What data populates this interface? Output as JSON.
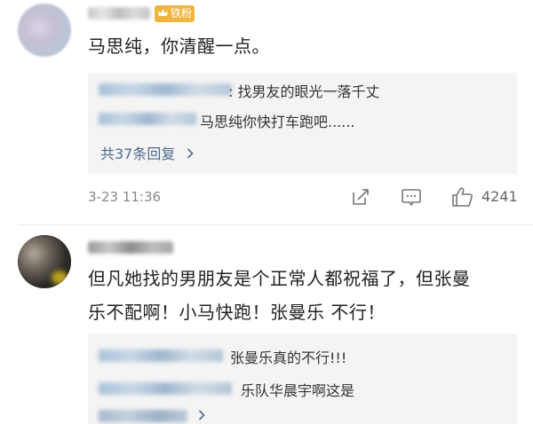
{
  "comments": [
    {
      "fan_badge": "铁粉",
      "text": "马思纯，你清醒一点。",
      "replies": [
        {
          "text": ": 找男友的眼光一落千丈"
        },
        {
          "text": "马思纯你快打车跑吧......"
        }
      ],
      "more_replies": "共37条回复",
      "more_icon": "chevron-right-icon",
      "timestamp": "3-23 11:36",
      "likes": "4241"
    },
    {
      "text_line1": "但凡她找的男朋友是个正常人都祝福了，但张曼",
      "text_line2": "乐不配啊！小马快跑！张曼乐 不行！",
      "replies": [
        {
          "text": "张曼乐真的不行!!!"
        },
        {
          "text": "乐队华晨宇啊这是"
        }
      ]
    }
  ],
  "colors": {
    "link": "#4e6b8c",
    "badge": "#f0b53e",
    "reply_bg": "#f4f4f4"
  }
}
